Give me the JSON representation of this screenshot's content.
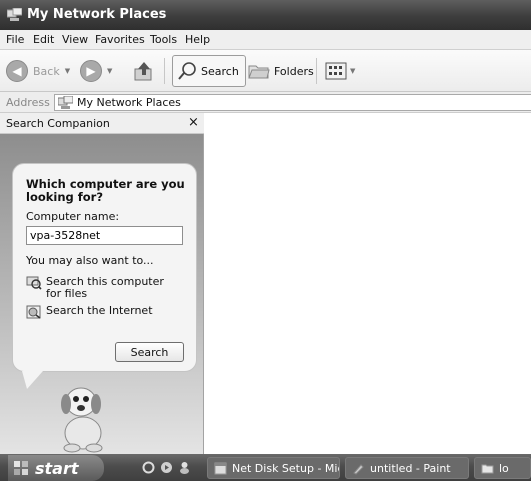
{
  "window": {
    "title": "My Network Places"
  },
  "menu": [
    "File",
    "Edit",
    "View",
    "Favorites",
    "Tools",
    "Help"
  ],
  "toolbar": {
    "back_label": "Back",
    "search_label": "Search",
    "folders_label": "Folders"
  },
  "address": {
    "label": "Address",
    "value": "My Network Places"
  },
  "search_pane": {
    "title": "Search Companion",
    "close_glyph": "×",
    "question": "Which computer are you looking for?",
    "computer_name_label": "Computer name:",
    "computer_name_value": "vpa-3528net",
    "also_label": "You may also want to...",
    "options": [
      "Search this computer for files",
      "Search the Internet"
    ],
    "search_button": "Search"
  },
  "taskbar": {
    "start_label": "start",
    "tasks": [
      "Net Disk Setup - Micr...",
      "untitled - Paint",
      "lo"
    ]
  },
  "icons": {
    "window": "network-places-icon",
    "back": "back-arrow-icon",
    "forward": "forward-arrow-icon",
    "up": "up-folder-icon",
    "search": "magnifier-icon",
    "folders": "folders-icon",
    "views": "views-icon",
    "address": "network-places-icon",
    "close": "close-icon",
    "option_1": "search-computer-icon",
    "option_2": "search-internet-icon",
    "assistant": "search-dog-icon"
  }
}
